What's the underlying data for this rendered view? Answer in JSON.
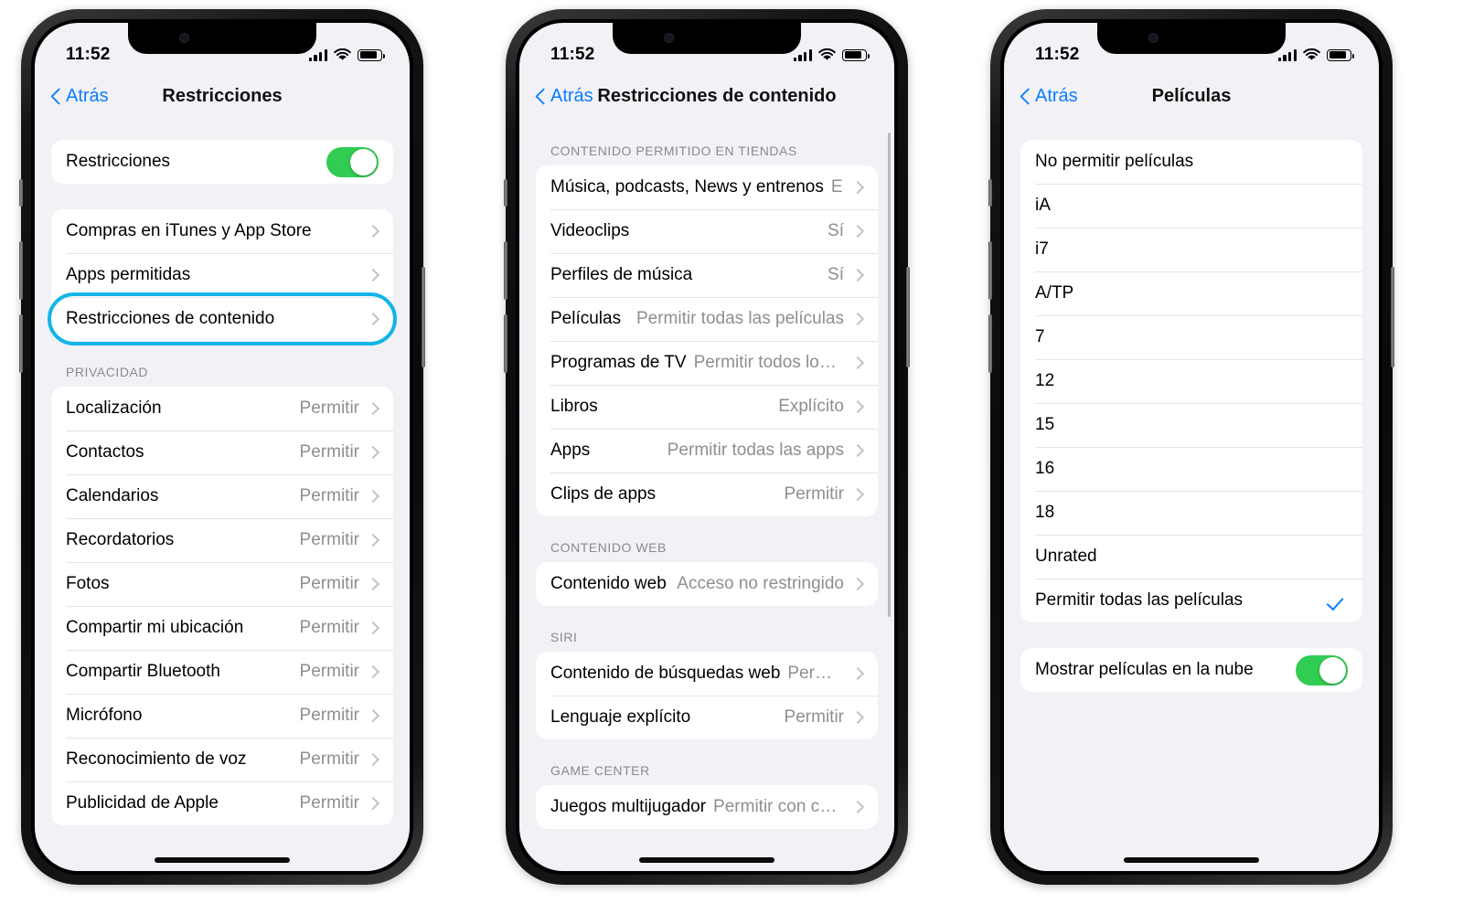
{
  "colors": {
    "accent_blue": "#0a7cff",
    "toggle_green": "#31cc52",
    "highlight_ring": "#12b4e8",
    "screen_bg": "#f1f1f6",
    "card_bg": "#ffffff",
    "secondary_text": "#8e8e93"
  },
  "status_bar": {
    "time": "11:52",
    "icons": [
      "cellular-signal-icon",
      "wifi-icon",
      "battery-icon"
    ]
  },
  "phones": [
    {
      "id": "phone-restricciones",
      "nav": {
        "back_label": "Atrás",
        "title": "Restricciones"
      },
      "sections": [
        {
          "header": "",
          "rows": [
            {
              "label": "Restricciones",
              "control": "toggle",
              "value": "on"
            }
          ]
        },
        {
          "header": "",
          "highlight_index": 2,
          "rows": [
            {
              "label": "Compras en iTunes y App Store",
              "value": "",
              "control": "chevron"
            },
            {
              "label": "Apps permitidas",
              "value": "",
              "control": "chevron"
            },
            {
              "label": "Restricciones de contenido",
              "value": "",
              "control": "chevron"
            }
          ]
        },
        {
          "header": "PRIVACIDAD",
          "rows": [
            {
              "label": "Localización",
              "value": "Permitir",
              "control": "chevron"
            },
            {
              "label": "Contactos",
              "value": "Permitir",
              "control": "chevron"
            },
            {
              "label": "Calendarios",
              "value": "Permitir",
              "control": "chevron"
            },
            {
              "label": "Recordatorios",
              "value": "Permitir",
              "control": "chevron"
            },
            {
              "label": "Fotos",
              "value": "Permitir",
              "control": "chevron"
            },
            {
              "label": "Compartir mi ubicación",
              "value": "Permitir",
              "control": "chevron"
            },
            {
              "label": "Compartir Bluetooth",
              "value": "Permitir",
              "control": "chevron"
            },
            {
              "label": "Micrófono",
              "value": "Permitir",
              "control": "chevron"
            },
            {
              "label": "Reconocimiento de voz",
              "value": "Permitir",
              "control": "chevron"
            },
            {
              "label": "Publicidad de Apple",
              "value": "Permitir",
              "control": "chevron"
            }
          ]
        }
      ]
    },
    {
      "id": "phone-restricciones-contenido",
      "nav": {
        "back_label": "Atrás",
        "title": "Restricciones de contenido"
      },
      "scrollbar": true,
      "sections": [
        {
          "header": "CONTENIDO PERMITIDO EN TIENDAS",
          "rows": [
            {
              "label": "Música, podcasts, News y entrenos",
              "value": "E...",
              "control": "chevron"
            },
            {
              "label": "Videoclips",
              "value": "Sí",
              "control": "chevron"
            },
            {
              "label": "Perfiles de música",
              "value": "Sí",
              "control": "chevron"
            },
            {
              "label": "Películas",
              "value": "Permitir todas las películas",
              "control": "chevron"
            },
            {
              "label": "Programas de TV",
              "value": "Permitir todos los pr...",
              "control": "chevron"
            },
            {
              "label": "Libros",
              "value": "Explícito",
              "control": "chevron"
            },
            {
              "label": "Apps",
              "value": "Permitir todas las apps",
              "control": "chevron"
            },
            {
              "label": "Clips de apps",
              "value": "Permitir",
              "control": "chevron"
            }
          ]
        },
        {
          "header": "CONTENIDO WEB",
          "rows": [
            {
              "label": "Contenido web",
              "value": "Acceso no restringido",
              "control": "chevron"
            }
          ]
        },
        {
          "header": "SIRI",
          "rows": [
            {
              "label": "Contenido de búsquedas web",
              "value": "Permitir",
              "control": "chevron"
            },
            {
              "label": "Lenguaje explícito",
              "value": "Permitir",
              "control": "chevron"
            }
          ]
        },
        {
          "header": "GAME CENTER",
          "rows": [
            {
              "label": "Juegos multijugador",
              "value": "Permitir con cual...",
              "control": "chevron"
            }
          ]
        }
      ]
    },
    {
      "id": "phone-peliculas",
      "nav": {
        "back_label": "Atrás",
        "title": "Películas"
      },
      "sections": [
        {
          "header": "",
          "rows": [
            {
              "label": "No permitir películas",
              "value": "",
              "control": "none"
            },
            {
              "label": "iA",
              "value": "",
              "control": "none"
            },
            {
              "label": "i7",
              "value": "",
              "control": "none"
            },
            {
              "label": "A/TP",
              "value": "",
              "control": "none"
            },
            {
              "label": "7",
              "value": "",
              "control": "none"
            },
            {
              "label": "12",
              "value": "",
              "control": "none"
            },
            {
              "label": "15",
              "value": "",
              "control": "none"
            },
            {
              "label": "16",
              "value": "",
              "control": "none"
            },
            {
              "label": "18",
              "value": "",
              "control": "none"
            },
            {
              "label": "Unrated",
              "value": "",
              "control": "none"
            },
            {
              "label": "Permitir todas las películas",
              "value": "",
              "control": "check"
            }
          ]
        },
        {
          "header": "",
          "rows": [
            {
              "label": "Mostrar películas en la nube",
              "control": "toggle",
              "value": "on"
            }
          ]
        }
      ]
    }
  ]
}
